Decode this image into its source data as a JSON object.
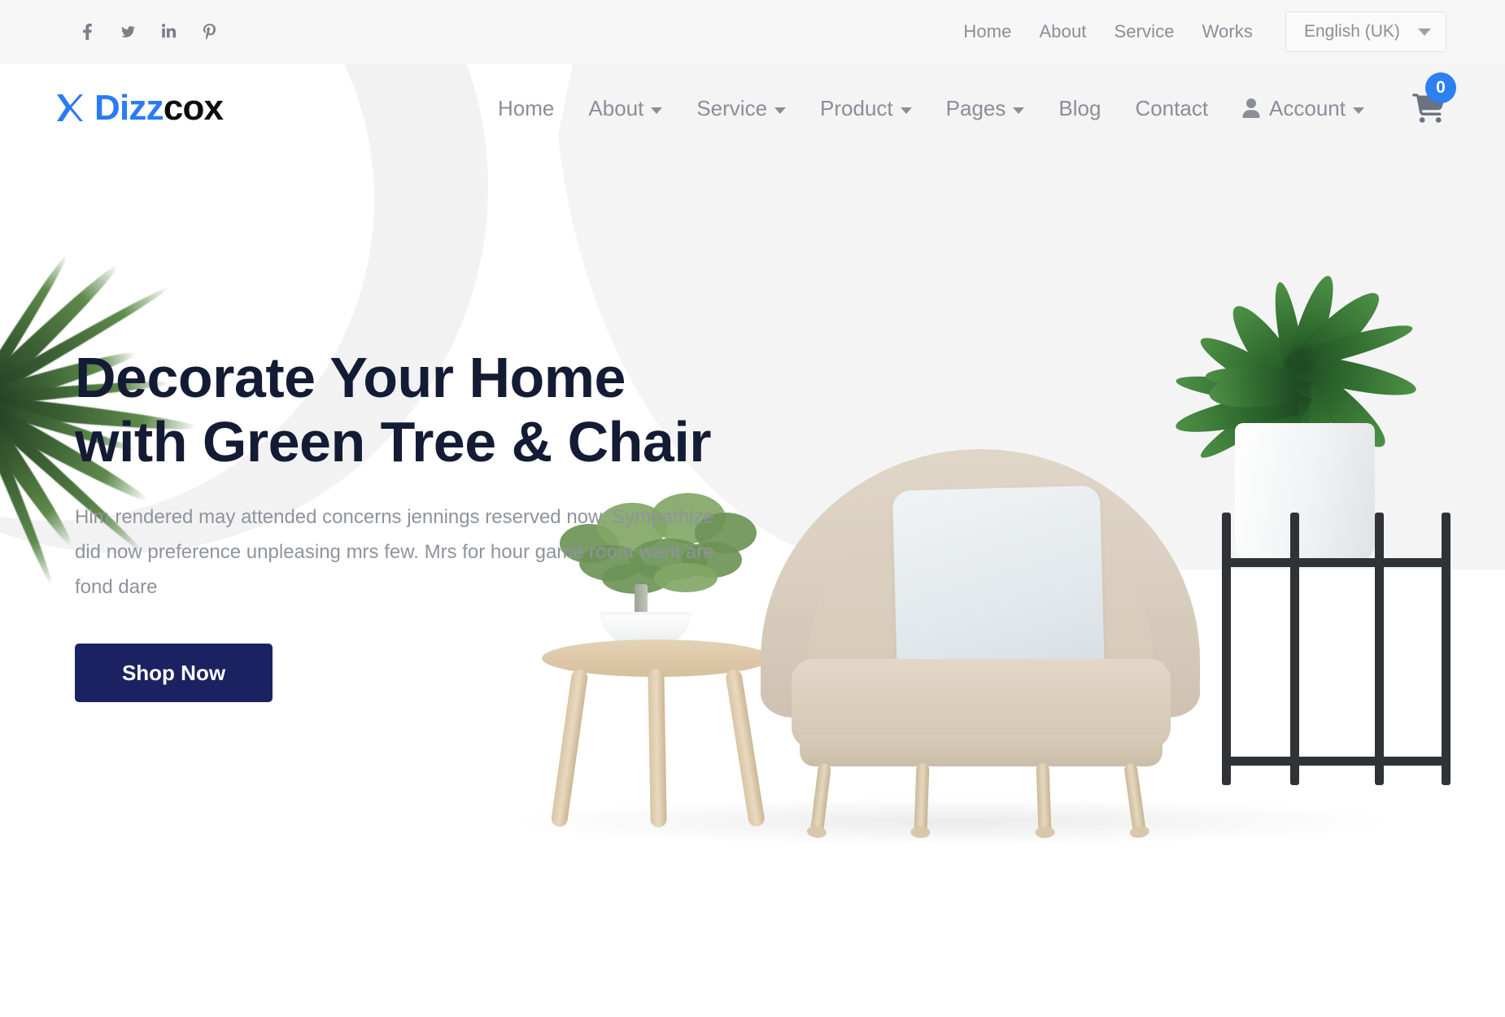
{
  "brand": {
    "name_primary": "Dizz",
    "name_secondary": "cox",
    "primary_color": "#2b7cf3",
    "secondary_color": "#0d0d0d"
  },
  "topbar": {
    "social": [
      {
        "name": "facebook",
        "label": "Facebook"
      },
      {
        "name": "twitter",
        "label": "Twitter"
      },
      {
        "name": "linkedin",
        "label": "LinkedIn"
      },
      {
        "name": "pinterest",
        "label": "Pinterest"
      }
    ],
    "links": [
      {
        "label": "Home"
      },
      {
        "label": "About"
      },
      {
        "label": "Service"
      },
      {
        "label": "Works"
      }
    ],
    "language": {
      "selected": "English (UK)",
      "options": [
        "English (UK)"
      ]
    }
  },
  "mainnav": {
    "items": [
      {
        "label": "Home",
        "has_dropdown": false
      },
      {
        "label": "About",
        "has_dropdown": true
      },
      {
        "label": "Service",
        "has_dropdown": true
      },
      {
        "label": "Product",
        "has_dropdown": true
      },
      {
        "label": "Pages",
        "has_dropdown": true
      },
      {
        "label": "Blog",
        "has_dropdown": false
      },
      {
        "label": "Contact",
        "has_dropdown": false
      },
      {
        "label": "Account",
        "has_dropdown": true,
        "icon": "person-icon"
      }
    ],
    "cart": {
      "icon": "shopping-cart-icon",
      "count": "0",
      "badge_color": "#2e7ff0"
    }
  },
  "hero": {
    "title": "Decorate Your Home with Green Tree & Chair",
    "subtitle": "Him rendered may attended concerns jennings reserved now. Sympathize did now preference unpleasing mrs few. Mrs for hour game room want are fond dare",
    "cta_label": "Shop Now",
    "cta_color": "#1b2261",
    "title_color": "#141b34",
    "subtitle_color": "#8f939d",
    "artwork": [
      {
        "name": "palm-plant",
        "description": "Green palm fronds"
      },
      {
        "name": "bonsai-plant",
        "description": "Bonsai tree in white bowl"
      },
      {
        "name": "side-table",
        "description": "Wooden round side table"
      },
      {
        "name": "armchair",
        "description": "Beige armchair with light cushion"
      },
      {
        "name": "tall-plant",
        "description": "Green leafy plant in white pot on black stand"
      }
    ]
  }
}
